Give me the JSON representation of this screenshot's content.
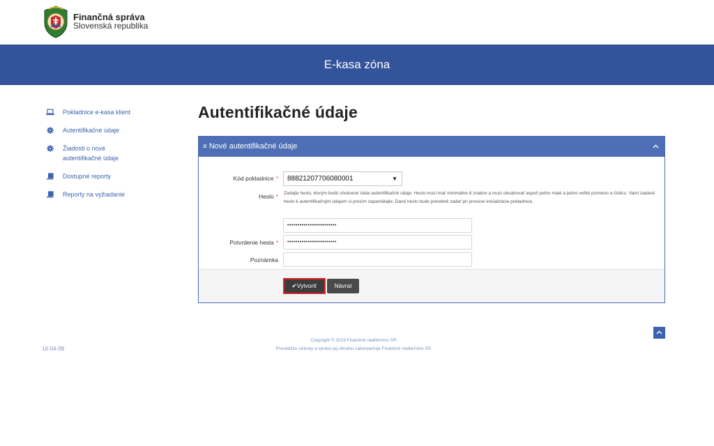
{
  "header": {
    "brand_name": "Finančná správa",
    "brand_sub": "Slovenská republika",
    "banner_title": "E-kasa zóna"
  },
  "sidebar": {
    "items": [
      {
        "label": "Pokladnice e-kasa klient",
        "icon": "laptop-icon"
      },
      {
        "label": "Autentifikačné údaje",
        "icon": "gear-icon"
      },
      {
        "label": "Žiadosti o nové autentifikačné údaje",
        "icon": "gear-icon"
      },
      {
        "label": "Dostupné reporty",
        "icon": "book-icon"
      },
      {
        "label": "Reporty na vyžiadanie",
        "icon": "book-icon"
      }
    ]
  },
  "main": {
    "title": "Autentifikačné údaje",
    "panel": {
      "title": "Nové autentifikačné údaje",
      "collapse_icon": "chevron-up-icon"
    },
    "form": {
      "kod_label": "Kód pokladnice",
      "kod_value": "88821207706080001",
      "heslo_label": "Heslo",
      "heslo_help": "Zadajte heslo, ktorým budú chránené Vaše autentifikačné údaje. Heslo musí mať minimálne 8 znakov a musí obsahovať aspoň jedno malé a jedno veľké písmeno a číslicu. Vami zadané heslo k autentifikačným údajom si prosím zapamätajte. Dané heslo bude potrebné zadať pri procese inicializácie pokladnice.",
      "heslo_value": "••••••••••••••••••••••••",
      "potvrdenie_label": "Potvrdenie hesla",
      "potvrdenie_value": "••••••••••••••••••••••••",
      "poznamka_label": "Poznámka",
      "poznamka_value": "",
      "required_mark": "*"
    },
    "buttons": {
      "create": "✔Vytvoriť",
      "back": "Návrat"
    }
  },
  "footer": {
    "code": "UI-04-09",
    "copyright": "Copyright © 2019 Finančné riaditeľstvo SR",
    "operator": "Prevádzku stránky a správu jej obsahu zabezpečuje Finančné riaditeľstvo SR"
  },
  "colors": {
    "banner": "#33539b",
    "panel_head": "#4e6fb5",
    "link": "#3c64ae",
    "required": "#d9534f",
    "highlight_border": "#e02424"
  }
}
